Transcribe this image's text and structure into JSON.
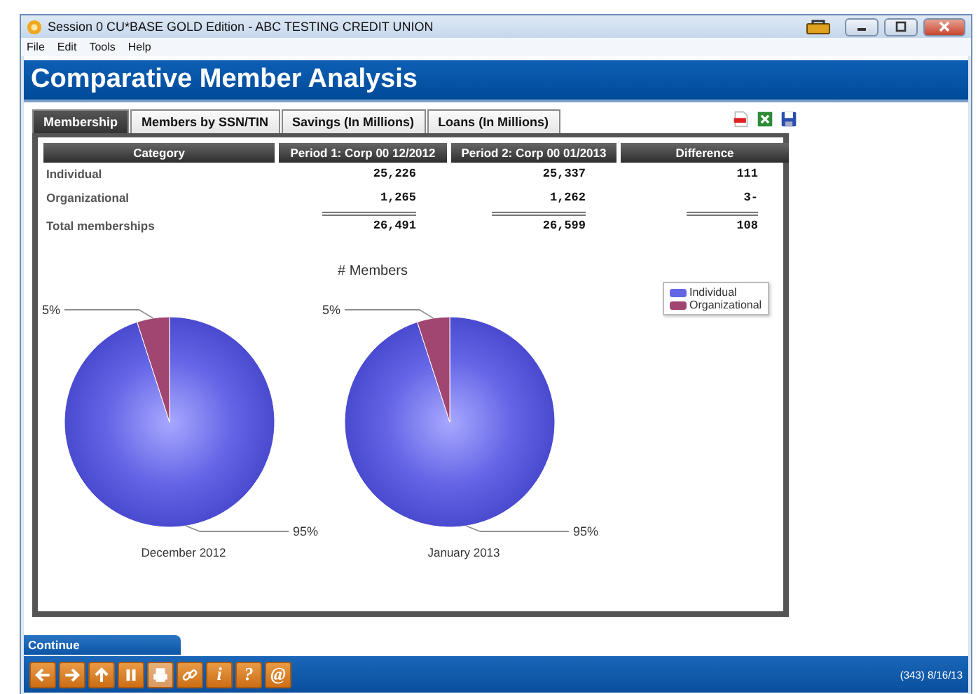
{
  "window": {
    "title": "Session 0 CU*BASE GOLD Edition - ABC TESTING CREDIT UNION"
  },
  "menu": [
    "File",
    "Edit",
    "Tools",
    "Help"
  ],
  "header": {
    "title": "Comparative Member Analysis"
  },
  "tabs": [
    {
      "label": "Membership",
      "selected": true
    },
    {
      "label": "Members by SSN/TIN",
      "selected": false
    },
    {
      "label": "Savings (In Millions)",
      "selected": false
    },
    {
      "label": "Loans (In Millions)",
      "selected": false
    }
  ],
  "table": {
    "columns": [
      "Category",
      "Period 1:  Corp 00  12/2012",
      "Period 2:  Corp 00  01/2013",
      "Difference"
    ],
    "rows": [
      {
        "kind": "item",
        "cells": [
          "Individual",
          "25,226",
          "25,337",
          "111"
        ]
      },
      {
        "kind": "item",
        "cells": [
          "Organizational",
          "1,265",
          "1,262",
          "3-"
        ]
      },
      {
        "kind": "total",
        "cells": [
          "Total memberships",
          "26,491",
          "26,599",
          "108"
        ]
      }
    ]
  },
  "charts": {
    "title": "# Members",
    "legend": [
      {
        "label": "Individual",
        "color": "#6464e6"
      },
      {
        "label": "Organizational",
        "color": "#a04670"
      }
    ],
    "pies": [
      {
        "caption": "December 2012",
        "chart_data": {
          "type": "pie",
          "values": [
            95,
            5
          ],
          "value_labels": [
            "95%",
            "5%"
          ]
        }
      },
      {
        "caption": "January 2013",
        "chart_data": {
          "type": "pie",
          "values": [
            95,
            5
          ],
          "value_labels": [
            "95%",
            "5%"
          ]
        }
      }
    ]
  },
  "continue": {
    "label": "Continue"
  },
  "toolbar": [
    {
      "kind": "back",
      "disabled": false
    },
    {
      "kind": "forward",
      "disabled": false
    },
    {
      "kind": "up",
      "disabled": false
    },
    {
      "kind": "pause",
      "disabled": false
    },
    {
      "kind": "print",
      "disabled": true
    },
    {
      "kind": "link",
      "disabled": false
    },
    {
      "kind": "text",
      "label": "i",
      "disabled": false
    },
    {
      "kind": "text",
      "label": "?",
      "disabled": false
    },
    {
      "kind": "text",
      "label": "@",
      "disabled": false
    }
  ],
  "status": "(343) 8/16/13"
}
